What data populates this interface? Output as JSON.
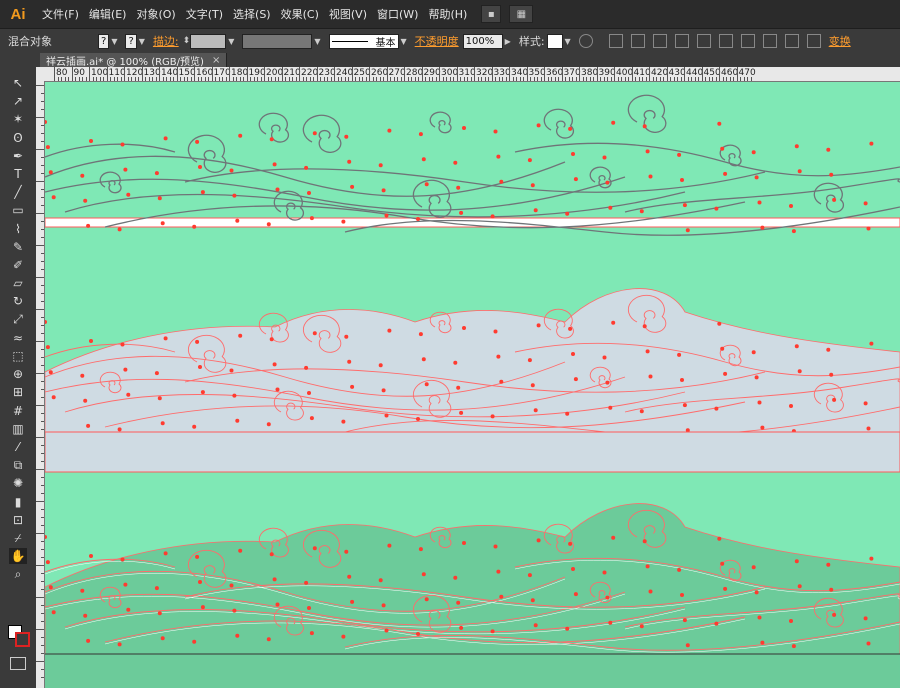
{
  "app": {
    "logo": "Ai"
  },
  "menu": [
    "文件(F)",
    "编辑(E)",
    "对象(O)",
    "文字(T)",
    "选择(S)",
    "效果(C)",
    "视图(V)",
    "窗口(W)",
    "帮助(H)"
  ],
  "control_bar": {
    "object_type": "混合对象",
    "stroke_label": "描边:",
    "stroke_profile": "基本",
    "opacity_label": "不透明度",
    "opacity_value": "100%",
    "style_label": "样式:",
    "transform_label": "变换"
  },
  "document_tab": {
    "title": "祥云插画.ai* @ 100% (RGB/预览)",
    "close": "×"
  },
  "ruler": {
    "top_labels": [
      "80",
      "90",
      "100",
      "110",
      "120",
      "130",
      "140",
      "150",
      "160",
      "170",
      "180",
      "190",
      "200",
      "210",
      "220",
      "230",
      "240",
      "250",
      "260",
      "270",
      "280",
      "290",
      "300",
      "310",
      "320",
      "330",
      "340",
      "350",
      "360",
      "370",
      "380",
      "390",
      "400",
      "410",
      "420",
      "430",
      "440",
      "450",
      "460",
      "470"
    ]
  },
  "colors": {
    "canvas_bg": "#7fe8b5",
    "band_light": "#cfdbe3",
    "band_green": "#6ccb9a",
    "stroke_gray": "#6f7478",
    "anchor_red": "#ff3b30"
  },
  "tools": [
    "selection-tool",
    "direct-selection-tool",
    "magic-wand-tool",
    "lasso-tool",
    "pen-tool",
    "type-tool",
    "line-tool",
    "rectangle-tool",
    "paintbrush-tool",
    "pencil-tool",
    "blob-brush-tool",
    "eraser-tool",
    "rotate-tool",
    "scale-tool",
    "warp-tool",
    "free-transform-tool",
    "shape-builder-tool",
    "perspective-tool",
    "mesh-tool",
    "gradient-tool",
    "eyedropper-tool",
    "blend-tool",
    "symbol-sprayer-tool",
    "column-graph-tool",
    "artboard-tool",
    "slice-tool",
    "hand-tool",
    "zoom-tool"
  ]
}
